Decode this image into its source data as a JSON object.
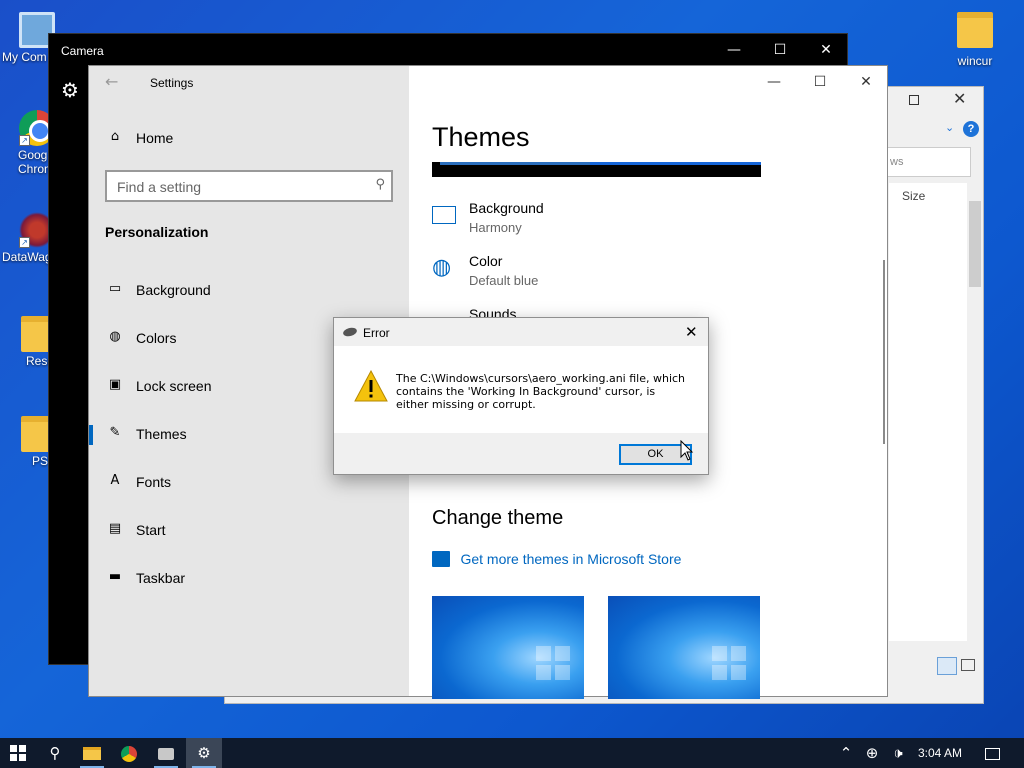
{
  "desktop": {
    "icons": [
      {
        "label": "My Com",
        "icon": "computer-icon"
      },
      {
        "label": "Goog Chron",
        "icon": "chrome-icon"
      },
      {
        "label": "DataWag",
        "icon": "datawagon-icon"
      },
      {
        "label": "Rese",
        "icon": "folder-icon"
      },
      {
        "label": "PS",
        "icon": "folder-icon"
      },
      {
        "label": "wincur",
        "icon": "folder-icon"
      }
    ]
  },
  "camera_window": {
    "title": "Camera"
  },
  "settings": {
    "title": "Settings",
    "home_label": "Home",
    "search_placeholder": "Find a setting",
    "section_heading": "Personalization",
    "nav_items": [
      {
        "label": "Background",
        "icon": "image-icon"
      },
      {
        "label": "Colors",
        "icon": "palette-icon"
      },
      {
        "label": "Lock screen",
        "icon": "lock-screen-icon"
      },
      {
        "label": "Themes",
        "icon": "brush-icon",
        "selected": true
      },
      {
        "label": "Fonts",
        "icon": "fonts-icon"
      },
      {
        "label": "Start",
        "icon": "start-icon"
      },
      {
        "label": "Taskbar",
        "icon": "taskbar-icon"
      }
    ],
    "page_title": "Themes",
    "theme_settings": [
      {
        "title": "Background",
        "value": "Harmony"
      },
      {
        "title": "Color",
        "value": "Default blue"
      },
      {
        "title": "Sounds",
        "value": ""
      }
    ],
    "change_theme_heading": "Change theme",
    "store_link": "Get more themes in Microsoft Store"
  },
  "error_dialog": {
    "title": "Error",
    "message": "The C:\\Windows\\cursors\\aero_working.ani file, which contains the 'Working In Background' cursor, is either missing or corrupt.",
    "ok_label": "OK"
  },
  "explorer": {
    "column_header": "Size",
    "search_fragment": "ws"
  },
  "taskbar": {
    "time": "3:04 AM",
    "accent": "#0f1a2c"
  }
}
